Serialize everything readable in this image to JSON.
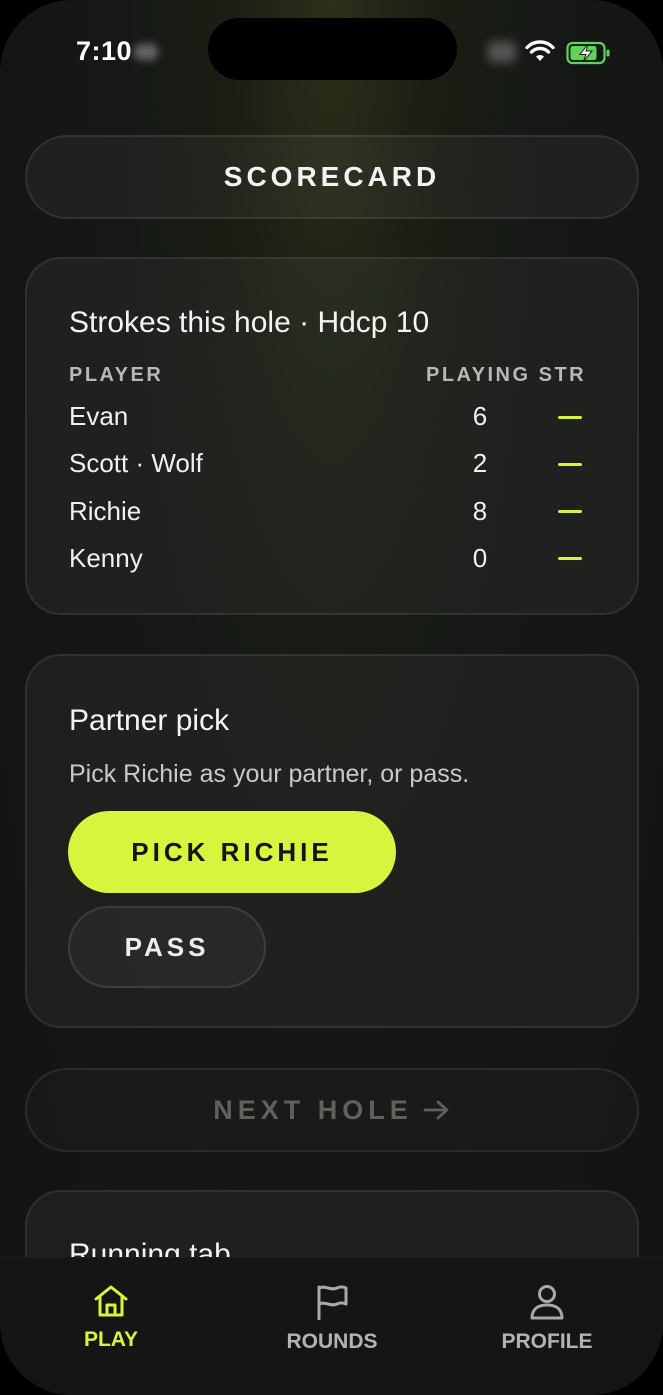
{
  "status_bar": {
    "time": "7:10"
  },
  "scorecard_button": {
    "label": "SCORECARD"
  },
  "strokes": {
    "title": "Strokes this hole · Hdcp 10",
    "col_player": "PLAYER",
    "col_playing_str": "PLAYING STR",
    "rows": [
      {
        "name": "Evan",
        "playing": "6",
        "str": "—"
      },
      {
        "name": "Scott · Wolf",
        "playing": "2",
        "str": "—"
      },
      {
        "name": "Richie",
        "playing": "8",
        "str": "—"
      },
      {
        "name": "Kenny",
        "playing": "0",
        "str": "—"
      }
    ]
  },
  "partner": {
    "title": "Partner pick",
    "description": "Pick Richie as your partner, or pass.",
    "pick_label": "PICK RICHIE",
    "pass_label": "PASS"
  },
  "next_hole": {
    "label": "NEXT HOLE"
  },
  "running_tab": {
    "title": "Running tab"
  },
  "tabbar": {
    "items": [
      {
        "label": "PLAY",
        "icon": "home-icon",
        "active": true
      },
      {
        "label": "ROUNDS",
        "icon": "flag-icon",
        "active": false
      },
      {
        "label": "PROFILE",
        "icon": "person-icon",
        "active": false
      }
    ]
  },
  "colors": {
    "accent": "#d8f53d",
    "background": "#151815"
  }
}
